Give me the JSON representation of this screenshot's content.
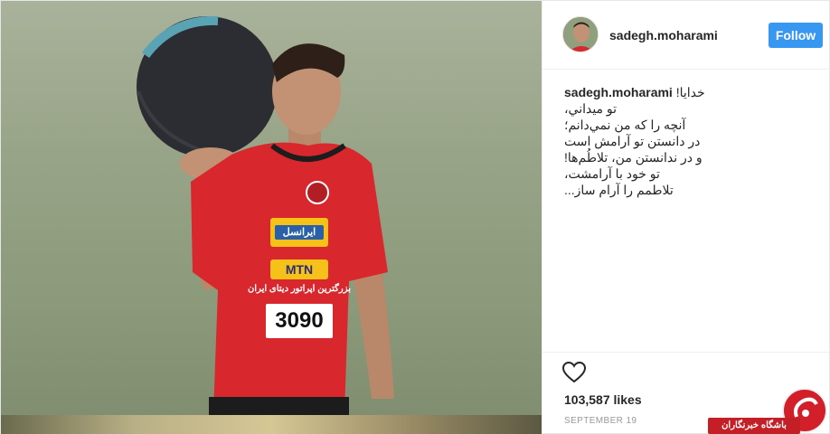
{
  "post": {
    "username": "sadegh.moharami",
    "follow_label": "Follow",
    "caption": {
      "author": "sadegh.moharami",
      "lines": [
        "خدايا!",
        "تو ميداني،",
        "آنچه را که من نمي‌دانم؛",
        "در دانستن تو آرامش است",
        "و در ندانستن من، تلاطُم‌ها!",
        "تو خود با آرامشت،",
        "تلاطمم را آرام ساز..."
      ]
    },
    "likes": "103,587 likes",
    "date": "SEPTEMBER 19"
  },
  "photo": {
    "jersey_number": "3090",
    "sponsor_1": "ایرانسل",
    "sponsor_2": "MTN",
    "sponsor_3": "بزرگترین اپراتور دیتای ایران"
  },
  "watermark": {
    "label": "باشگاه خبرنگاران"
  },
  "icons": {
    "like": "heart-icon",
    "watermark_logo": "news-club-logo-icon"
  },
  "colors": {
    "follow_button": "#3897f0",
    "jersey_red": "#d9272e",
    "watermark_red": "#c41e27"
  }
}
